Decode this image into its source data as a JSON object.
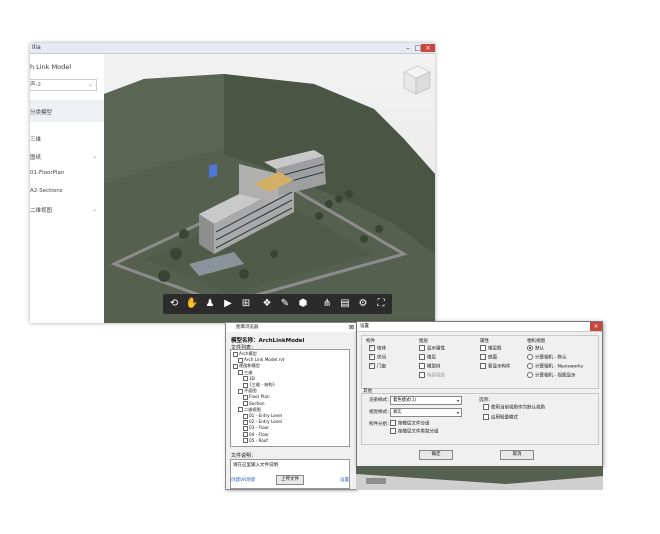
{
  "viewer": {
    "window_title": "Ilia",
    "sidebar": {
      "title": "h Link Model",
      "select_value": "声-2",
      "items": [
        {
          "label": "分类模型",
          "has_chevron": false
        },
        {
          "label": "三维",
          "has_chevron": false
        },
        {
          "label": "图纸",
          "has_chevron": true
        },
        {
          "label": "01-FloorPlan",
          "has_chevron": false
        },
        {
          "label": "A2-Sections",
          "has_chevron": false
        },
        {
          "label": "二维视图",
          "has_chevron": true
        }
      ]
    },
    "toolbar": {
      "icons": [
        "orbit-icon",
        "pan-icon",
        "walk-person-icon",
        "camera-icon",
        "section-box-icon",
        "explode-icon",
        "measure-icon",
        "view-cube-icon",
        "model-tree-icon",
        "properties-icon",
        "settings-gear-icon",
        "fullscreen-icon"
      ]
    }
  },
  "browser": {
    "title": "图库浏览器",
    "model_name_label": "模型名称：",
    "model_name_value": "ArchLinkModel",
    "file_list_label": "文件列表：",
    "tree": [
      {
        "indent": 0,
        "text": "Arch模型",
        "cb": false
      },
      {
        "indent": 1,
        "text": "Arch Link Model.rvt",
        "cb": true
      },
      {
        "indent": 0,
        "text": "视图和模型",
        "cb": false
      },
      {
        "indent": 1,
        "text": "三维",
        "cb": true
      },
      {
        "indent": 2,
        "text": "3D",
        "cb": true
      },
      {
        "indent": 2,
        "text": "{三维 - 结构}",
        "cb": true
      },
      {
        "indent": 1,
        "text": "平面图",
        "cb": true
      },
      {
        "indent": 2,
        "text": "Floor Plan",
        "cb": true
      },
      {
        "indent": 2,
        "text": "Section",
        "cb": true
      },
      {
        "indent": 1,
        "text": "二维视图",
        "cb": true
      },
      {
        "indent": 2,
        "text": "01 - Entry Level",
        "cb": true
      },
      {
        "indent": 2,
        "text": "02 - Entry Level",
        "cb": true
      },
      {
        "indent": 2,
        "text": "03 - Floor",
        "cb": true
      },
      {
        "indent": 2,
        "text": "04 - Floor",
        "cb": true
      },
      {
        "indent": 2,
        "text": "05 - Roof",
        "cb": true
      }
    ],
    "desc_label": "文件说明：",
    "desc_value": "请在这里输入文件说明",
    "upload_button": "上传文件",
    "left_link": "创建VR场景",
    "right_link": "设置"
  },
  "settings": {
    "title": "设置",
    "col_headers": [
      "构件",
      "图层",
      "属性",
      "相机视图"
    ],
    "col1": [
      {
        "label": "墙体",
        "on": true
      },
      {
        "label": "房间",
        "on": true
      },
      {
        "label": "门窗",
        "on": true
      }
    ],
    "col2": [
      {
        "label": "显示属性",
        "on": false
      },
      {
        "label": "楼层",
        "on": false
      },
      {
        "label": "模型树",
        "on": false
      },
      {
        "label": "构建视图",
        "on": false,
        "disabled": true
      }
    ],
    "col3": [
      {
        "label": "楼层框",
        "on": false
      },
      {
        "label": "剖面",
        "on": false
      },
      {
        "label": "要显示构件",
        "on": false
      }
    ],
    "col4": [
      {
        "label": "默认",
        "on": true
      },
      {
        "label": "计算相机 - 默认",
        "on": false
      },
      {
        "label": "计算相机 - Navisworks",
        "on": false
      },
      {
        "label": "计算相机 - 视图显示",
        "on": false
      }
    ],
    "section2_label": "其他",
    "row1_label": "渲染样式：",
    "row1_value": "着色模式(1)",
    "row2_label": "视觉样式：",
    "row2_value": "真实",
    "row3_label": "构件分组：",
    "row3_options": [
      {
        "label": "按楼层文件分组",
        "on": false
      },
      {
        "label": "按楼层文件类型分组",
        "on": false
      }
    ],
    "right_label": "选项：",
    "right_options": [
      {
        "label": "使用当前视角作为默认视角",
        "on": false
      },
      {
        "label": "启用轻量模式",
        "on": false
      }
    ],
    "ok_button": "确定",
    "cancel_button": "取消"
  },
  "colors": {
    "terrain": "#4d5a46",
    "building": "#b9b9b9",
    "courtyard": "#d4b067",
    "toolbar": "#2b2b2b",
    "link": "#1f5fbf"
  }
}
